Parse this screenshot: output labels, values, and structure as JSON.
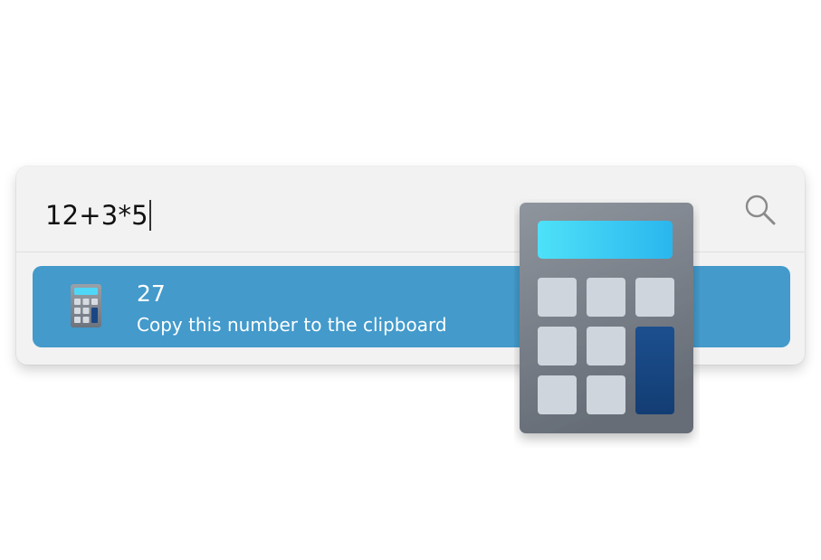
{
  "search": {
    "query": "12+3*5",
    "icon": "magnifier-icon"
  },
  "results": [
    {
      "title": "27",
      "subtitle": "Copy this number to the clipboard",
      "icon": "calculator-icon"
    }
  ],
  "colors": {
    "panel_bg": "#f2f2f2",
    "result_highlight": "#439acb",
    "calc_body": "#7c838d",
    "calc_display": "#3fd0f5",
    "calc_key": "#cfd5dc",
    "calc_equals_key": "#1a4784"
  }
}
